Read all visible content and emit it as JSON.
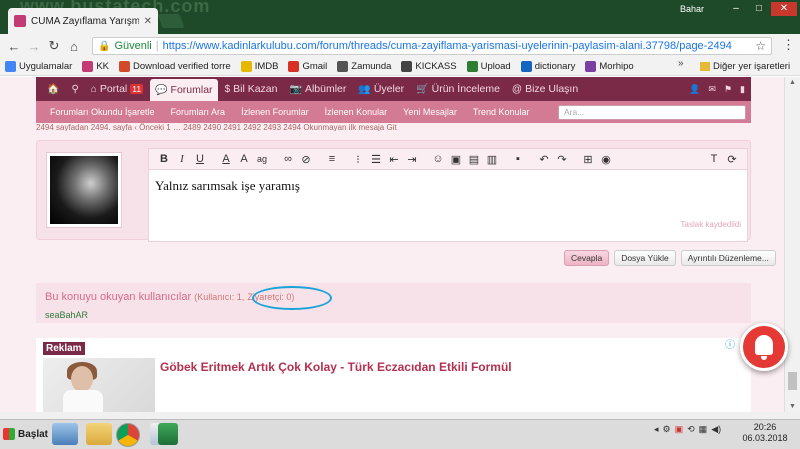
{
  "browser": {
    "watermark": "www.bustatech.com",
    "tab_title": "CUMA Zayıflama Yarışması",
    "profile_name": "Bahar",
    "secure_label": "Güvenli",
    "url": "https://www.kadinlarkulubu.com/forum/threads/cuma-zayiflama-yarismasi-uyelerinin-paylasim-alani.37798/page-2494",
    "bookmarks": [
      "Uygulamalar",
      "KK",
      "Download verified torre",
      "IMDB",
      "Gmail",
      "Zamunda",
      "KICKASS",
      "Upload",
      "dictionary",
      "Morhipo"
    ],
    "bookmark_colors": [
      "#4285f4",
      "#c33b74",
      "#d24a2a",
      "#e6b800",
      "#d93025",
      "#555555",
      "#444444",
      "#2e7d32",
      "#1565c0",
      "#7b3fa1"
    ],
    "more": "»",
    "other_bookmarks": "Diğer yer işaretleri"
  },
  "site_nav": {
    "items": [
      {
        "icon": "home-icon",
        "label": ""
      },
      {
        "icon": "pin-icon",
        "label": ""
      },
      {
        "icon": "house-icon",
        "label": "Portal",
        "badge": "11"
      },
      {
        "icon": "chat-icon",
        "label": "Forumlar",
        "active": true
      },
      {
        "icon": "money-icon",
        "label": "Bil Kazan"
      },
      {
        "icon": "camera-icon",
        "label": "Albümler"
      },
      {
        "icon": "users-icon",
        "label": "Üyeler"
      },
      {
        "icon": "cart-icon",
        "label": "Ürün İnceleme"
      },
      {
        "icon": "at-icon",
        "label": "Bize Ulaşın"
      }
    ]
  },
  "sub_nav": [
    "Forumları Okundu İşaretle",
    "Forumları Ara",
    "İzlenen Forumlar",
    "İzlenen Konular",
    "Yeni Mesajlar",
    "Trend Konular"
  ],
  "search_placeholder": "Ara...",
  "pagenav_text": "2494 sayfadan 2494. sayfa  ‹ Önceki  1 …  2489 2490 2491 2492 2493 2494   Okunmayan ilk mesaja Git",
  "editor": {
    "text": "Yalnız sarımsak işe yaramış",
    "draft_label": "Taslak kaydedildi"
  },
  "buttons": {
    "reply": "Cevapla",
    "upload": "Dosya Yükle",
    "advanced": "Ayrıntılı Düzenleme..."
  },
  "viewers": {
    "title": "Bu konuyu okuyan kullanıcılar",
    "count_members": "(Kullanıcı: 1,",
    "count_guests": "Ziyaretçi: 0)",
    "user": "seaBahAR"
  },
  "ad": {
    "tag": "Reklam",
    "info": "ⓘ",
    "title": "Göbek Eritmek Artık Çok Kolay - Türk Eczacıdan Etkili Formül"
  },
  "taskbar": {
    "start": "Başlat",
    "time": "20:26",
    "date": "06.03.2018"
  }
}
